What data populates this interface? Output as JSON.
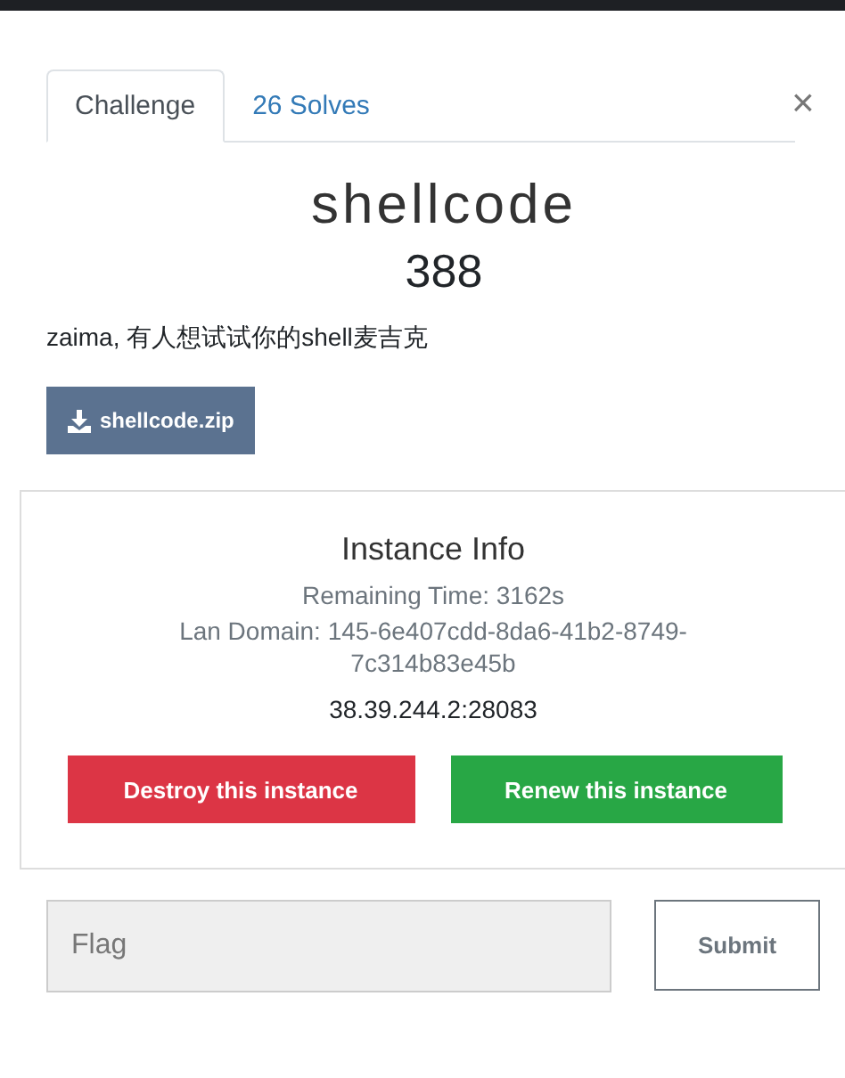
{
  "tabs": [
    {
      "label": "Challenge",
      "selected": true
    },
    {
      "label": "26 Solves",
      "selected": false
    }
  ],
  "close": "×",
  "challenge": {
    "name": "shellcode",
    "value": "388",
    "description": "zaima, 有人想试试你的shell麦吉克",
    "file": "shellcode.zip"
  },
  "instance": {
    "title": "Instance Info",
    "remaining": "Remaining Time: 3162s",
    "lan_domain": "Lan Domain: 145-6e407cdd-8da6-41b2-8749-7c314b83e45b",
    "address": "38.39.244.2:28083",
    "buttons": [
      {
        "label": "Destroy this instance",
        "kind": "danger"
      },
      {
        "label": "Renew this instance",
        "kind": "success"
      }
    ]
  },
  "flag": {
    "placeholder": "Flag"
  },
  "submit": "Submit"
}
